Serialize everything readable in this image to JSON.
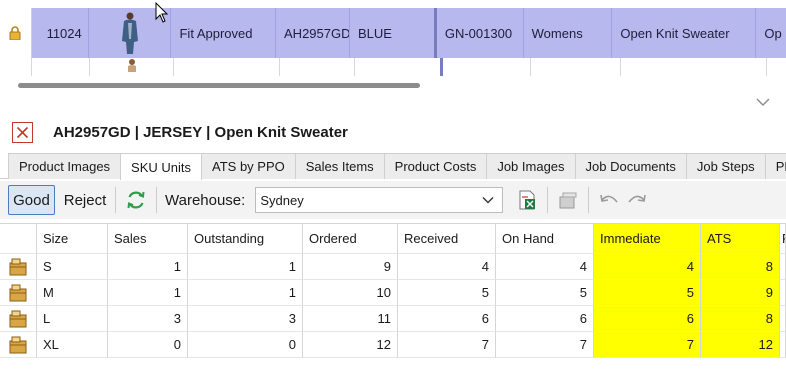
{
  "top_grid": {
    "row": {
      "id": "11024",
      "status": "Fit Approved",
      "style_code": "AH2957GD",
      "color": "BLUE",
      "job_code": "GN-001300",
      "gender": "Womens",
      "description": "Open Knit Sweater",
      "more": "Op"
    }
  },
  "title": "AH2957GD | JERSEY | Open Knit Sweater",
  "tabs": [
    {
      "label": "Product Images"
    },
    {
      "label": "SKU Units"
    },
    {
      "label": "ATS by PPO"
    },
    {
      "label": "Sales Items"
    },
    {
      "label": "Product Costs"
    },
    {
      "label": "Job Images"
    },
    {
      "label": "Job Documents"
    },
    {
      "label": "Job Steps"
    },
    {
      "label": "PPO I"
    }
  ],
  "active_tab": "SKU Units",
  "toolbar": {
    "good_label": "Good",
    "reject_label": "Reject",
    "warehouse_label": "Warehouse:",
    "warehouse_value": "Sydney"
  },
  "grid": {
    "headers": [
      "Size",
      "Sales",
      "Outstanding",
      "Ordered",
      "Received",
      "On Hand",
      "Immediate",
      "ATS",
      "F"
    ],
    "highlight_color": "#ffff00",
    "rows": [
      {
        "size": "S",
        "sales": "1",
        "outstanding": "1",
        "ordered": "9",
        "received": "4",
        "on_hand": "4",
        "immediate": "4",
        "ats": "8"
      },
      {
        "size": "M",
        "sales": "1",
        "outstanding": "1",
        "ordered": "10",
        "received": "5",
        "on_hand": "5",
        "immediate": "5",
        "ats": "9"
      },
      {
        "size": "L",
        "sales": "3",
        "outstanding": "3",
        "ordered": "11",
        "received": "6",
        "on_hand": "6",
        "immediate": "6",
        "ats": "8"
      },
      {
        "size": "XL",
        "sales": "0",
        "outstanding": "0",
        "ordered": "12",
        "received": "7",
        "on_hand": "7",
        "immediate": "7",
        "ats": "12"
      }
    ]
  },
  "colors": {
    "selected_row": "#b6b8ee",
    "accent": "#4a7cbf",
    "close_red": "#c0392b"
  },
  "icons": [
    "lock-icon",
    "product-thumbnail",
    "chevron-down-icon",
    "close-icon",
    "refresh-icon",
    "excel-export-icon",
    "stack-icon",
    "undo-icon",
    "redo-icon",
    "box-icon",
    "mouse-cursor-icon"
  ]
}
